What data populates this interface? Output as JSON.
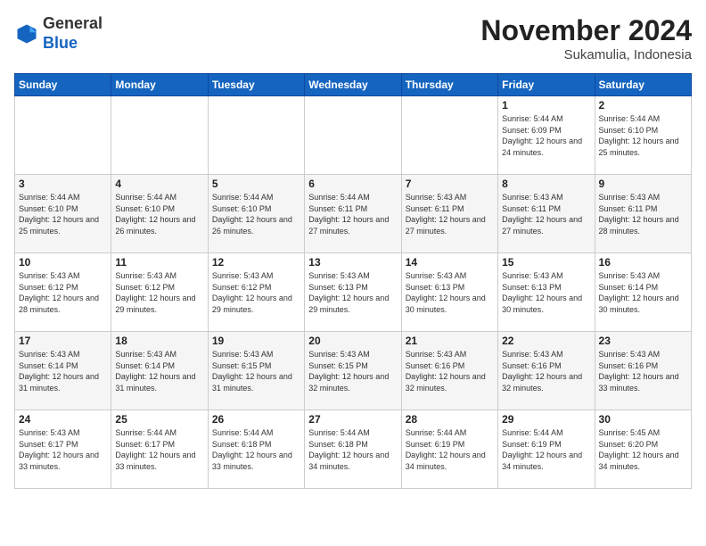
{
  "header": {
    "logo_general": "General",
    "logo_blue": "Blue",
    "month": "November 2024",
    "location": "Sukamulia, Indonesia"
  },
  "days_of_week": [
    "Sunday",
    "Monday",
    "Tuesday",
    "Wednesday",
    "Thursday",
    "Friday",
    "Saturday"
  ],
  "weeks": [
    [
      {
        "day": "",
        "info": ""
      },
      {
        "day": "",
        "info": ""
      },
      {
        "day": "",
        "info": ""
      },
      {
        "day": "",
        "info": ""
      },
      {
        "day": "",
        "info": ""
      },
      {
        "day": "1",
        "info": "Sunrise: 5:44 AM\nSunset: 6:09 PM\nDaylight: 12 hours and 24 minutes."
      },
      {
        "day": "2",
        "info": "Sunrise: 5:44 AM\nSunset: 6:10 PM\nDaylight: 12 hours and 25 minutes."
      }
    ],
    [
      {
        "day": "3",
        "info": "Sunrise: 5:44 AM\nSunset: 6:10 PM\nDaylight: 12 hours and 25 minutes."
      },
      {
        "day": "4",
        "info": "Sunrise: 5:44 AM\nSunset: 6:10 PM\nDaylight: 12 hours and 26 minutes."
      },
      {
        "day": "5",
        "info": "Sunrise: 5:44 AM\nSunset: 6:10 PM\nDaylight: 12 hours and 26 minutes."
      },
      {
        "day": "6",
        "info": "Sunrise: 5:44 AM\nSunset: 6:11 PM\nDaylight: 12 hours and 27 minutes."
      },
      {
        "day": "7",
        "info": "Sunrise: 5:43 AM\nSunset: 6:11 PM\nDaylight: 12 hours and 27 minutes."
      },
      {
        "day": "8",
        "info": "Sunrise: 5:43 AM\nSunset: 6:11 PM\nDaylight: 12 hours and 27 minutes."
      },
      {
        "day": "9",
        "info": "Sunrise: 5:43 AM\nSunset: 6:11 PM\nDaylight: 12 hours and 28 minutes."
      }
    ],
    [
      {
        "day": "10",
        "info": "Sunrise: 5:43 AM\nSunset: 6:12 PM\nDaylight: 12 hours and 28 minutes."
      },
      {
        "day": "11",
        "info": "Sunrise: 5:43 AM\nSunset: 6:12 PM\nDaylight: 12 hours and 29 minutes."
      },
      {
        "day": "12",
        "info": "Sunrise: 5:43 AM\nSunset: 6:12 PM\nDaylight: 12 hours and 29 minutes."
      },
      {
        "day": "13",
        "info": "Sunrise: 5:43 AM\nSunset: 6:13 PM\nDaylight: 12 hours and 29 minutes."
      },
      {
        "day": "14",
        "info": "Sunrise: 5:43 AM\nSunset: 6:13 PM\nDaylight: 12 hours and 30 minutes."
      },
      {
        "day": "15",
        "info": "Sunrise: 5:43 AM\nSunset: 6:13 PM\nDaylight: 12 hours and 30 minutes."
      },
      {
        "day": "16",
        "info": "Sunrise: 5:43 AM\nSunset: 6:14 PM\nDaylight: 12 hours and 30 minutes."
      }
    ],
    [
      {
        "day": "17",
        "info": "Sunrise: 5:43 AM\nSunset: 6:14 PM\nDaylight: 12 hours and 31 minutes."
      },
      {
        "day": "18",
        "info": "Sunrise: 5:43 AM\nSunset: 6:14 PM\nDaylight: 12 hours and 31 minutes."
      },
      {
        "day": "19",
        "info": "Sunrise: 5:43 AM\nSunset: 6:15 PM\nDaylight: 12 hours and 31 minutes."
      },
      {
        "day": "20",
        "info": "Sunrise: 5:43 AM\nSunset: 6:15 PM\nDaylight: 12 hours and 32 minutes."
      },
      {
        "day": "21",
        "info": "Sunrise: 5:43 AM\nSunset: 6:16 PM\nDaylight: 12 hours and 32 minutes."
      },
      {
        "day": "22",
        "info": "Sunrise: 5:43 AM\nSunset: 6:16 PM\nDaylight: 12 hours and 32 minutes."
      },
      {
        "day": "23",
        "info": "Sunrise: 5:43 AM\nSunset: 6:16 PM\nDaylight: 12 hours and 33 minutes."
      }
    ],
    [
      {
        "day": "24",
        "info": "Sunrise: 5:43 AM\nSunset: 6:17 PM\nDaylight: 12 hours and 33 minutes."
      },
      {
        "day": "25",
        "info": "Sunrise: 5:44 AM\nSunset: 6:17 PM\nDaylight: 12 hours and 33 minutes."
      },
      {
        "day": "26",
        "info": "Sunrise: 5:44 AM\nSunset: 6:18 PM\nDaylight: 12 hours and 33 minutes."
      },
      {
        "day": "27",
        "info": "Sunrise: 5:44 AM\nSunset: 6:18 PM\nDaylight: 12 hours and 34 minutes."
      },
      {
        "day": "28",
        "info": "Sunrise: 5:44 AM\nSunset: 6:19 PM\nDaylight: 12 hours and 34 minutes."
      },
      {
        "day": "29",
        "info": "Sunrise: 5:44 AM\nSunset: 6:19 PM\nDaylight: 12 hours and 34 minutes."
      },
      {
        "day": "30",
        "info": "Sunrise: 5:45 AM\nSunset: 6:20 PM\nDaylight: 12 hours and 34 minutes."
      }
    ]
  ]
}
